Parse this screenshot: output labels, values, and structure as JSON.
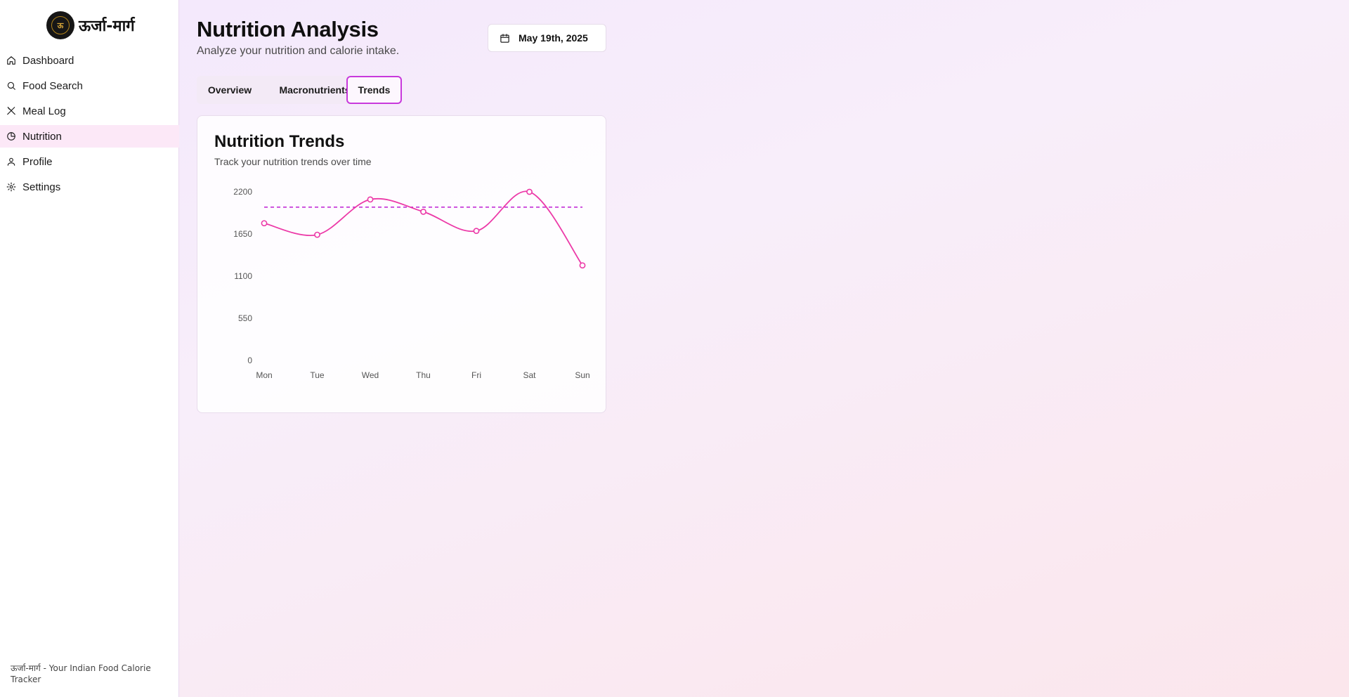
{
  "app": {
    "name": "ऊर्जा-मार्ग",
    "logo_text": "ऊ",
    "footer": "ऊर्जा-मार्ग - Your Indian Food Calorie Tracker"
  },
  "sidebar": {
    "items": [
      {
        "label": "Dashboard",
        "icon": "home-icon"
      },
      {
        "label": "Food Search",
        "icon": "search-icon"
      },
      {
        "label": "Meal Log",
        "icon": "utensils-icon"
      },
      {
        "label": "Nutrition",
        "icon": "pie-chart-icon",
        "active": true
      },
      {
        "label": "Profile",
        "icon": "user-icon"
      },
      {
        "label": "Settings",
        "icon": "gear-icon"
      }
    ]
  },
  "header": {
    "title": "Nutrition Analysis",
    "subtitle": "Analyze your nutrition and calorie intake.",
    "date": "May 19th, 2025"
  },
  "tabs": [
    {
      "label": "Overview"
    },
    {
      "label": "Macronutrients"
    },
    {
      "label": "Trends",
      "active": true
    }
  ],
  "card": {
    "title": "Nutrition Trends",
    "subtitle": "Track your nutrition trends over time"
  },
  "colors": {
    "accent": "#c839dc",
    "line": "#ec3aa8",
    "target": "#c32fd6",
    "active_nav_bg": "#fce8f7"
  },
  "chart_data": {
    "type": "line",
    "categories": [
      "Mon",
      "Tue",
      "Wed",
      "Thu",
      "Fri",
      "Sat",
      "Sun"
    ],
    "series": [
      {
        "values": [
          1790,
          1640,
          2100,
          1940,
          1690,
          2200,
          1240
        ]
      }
    ],
    "reference_line": 2000,
    "yticks": [
      0,
      550,
      1100,
      1650,
      2200
    ],
    "ylim": [
      0,
      2200
    ],
    "curve": "smooth",
    "grid": false,
    "legend": "none"
  }
}
